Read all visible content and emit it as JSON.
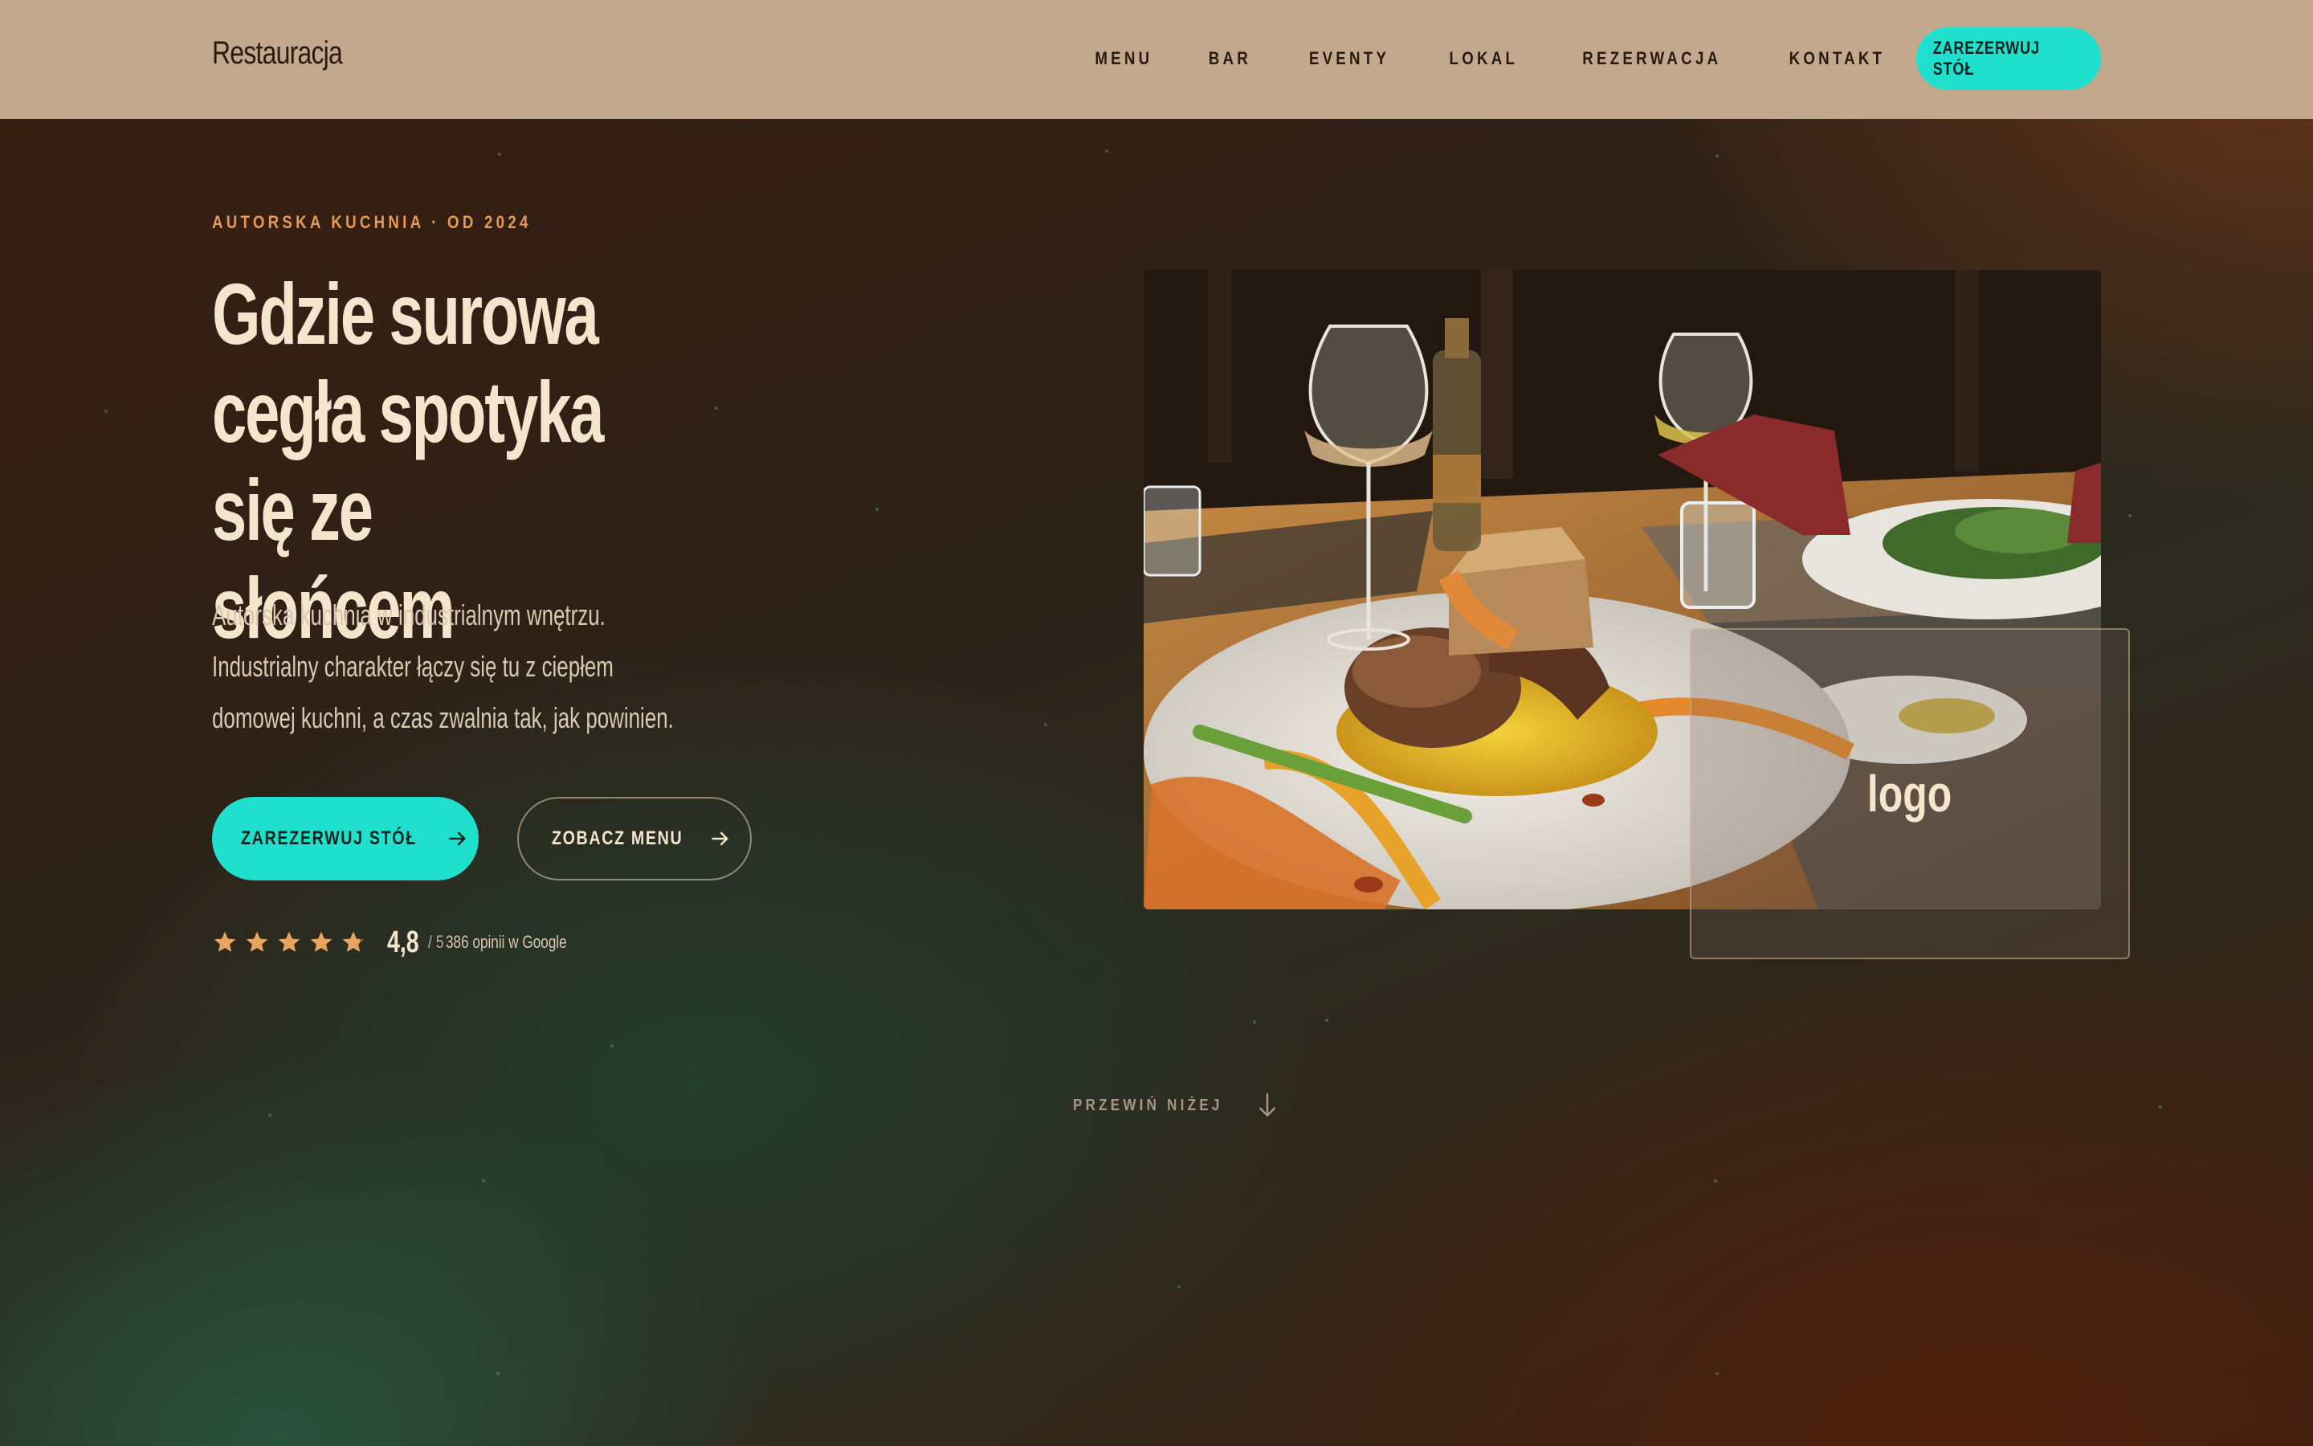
{
  "nav": {
    "brand": "Restauracja",
    "items": [
      {
        "label": "MENU"
      },
      {
        "label": "BAR"
      },
      {
        "label": "EVENTY"
      },
      {
        "label": "LOKAL"
      },
      {
        "label": "REZERWACJA"
      },
      {
        "label": "KONTAKT"
      }
    ],
    "cta_label": "ZAREZERWUJ STÓŁ"
  },
  "hero": {
    "eyebrow": "AUTORSKA KUCHNIA · OD 2024",
    "title": "Gdzie surowa cegła spotyka się ze słońcem",
    "lead": "Autorska kuchnia w industrialnym wnętrzu. Industrialny charakter łączy się tu z ciepłem domowej kuchni, a czas zwalnia tak, jak powinien.",
    "primary_button": "ZAREZERWUJ STÓŁ",
    "secondary_button": "ZOBACZ MENU",
    "rating": {
      "score": "4,8",
      "max": "/ 5",
      "reviews": "386 opinii w Google",
      "stars_value": 4.8
    },
    "logo_card": "logo",
    "scroll_label": "PRZEWIŃ NIŻEJ"
  },
  "colors": {
    "nav_bg": "#c2a88c",
    "accent": "#1fe0cc",
    "eyebrow": "#e69a55",
    "heading": "#f4e6cc",
    "star": "#e8a35c"
  },
  "icons": {
    "arrow": "arrow-right-icon",
    "star": "star-icon",
    "scroll": "arrow-down-icon"
  }
}
